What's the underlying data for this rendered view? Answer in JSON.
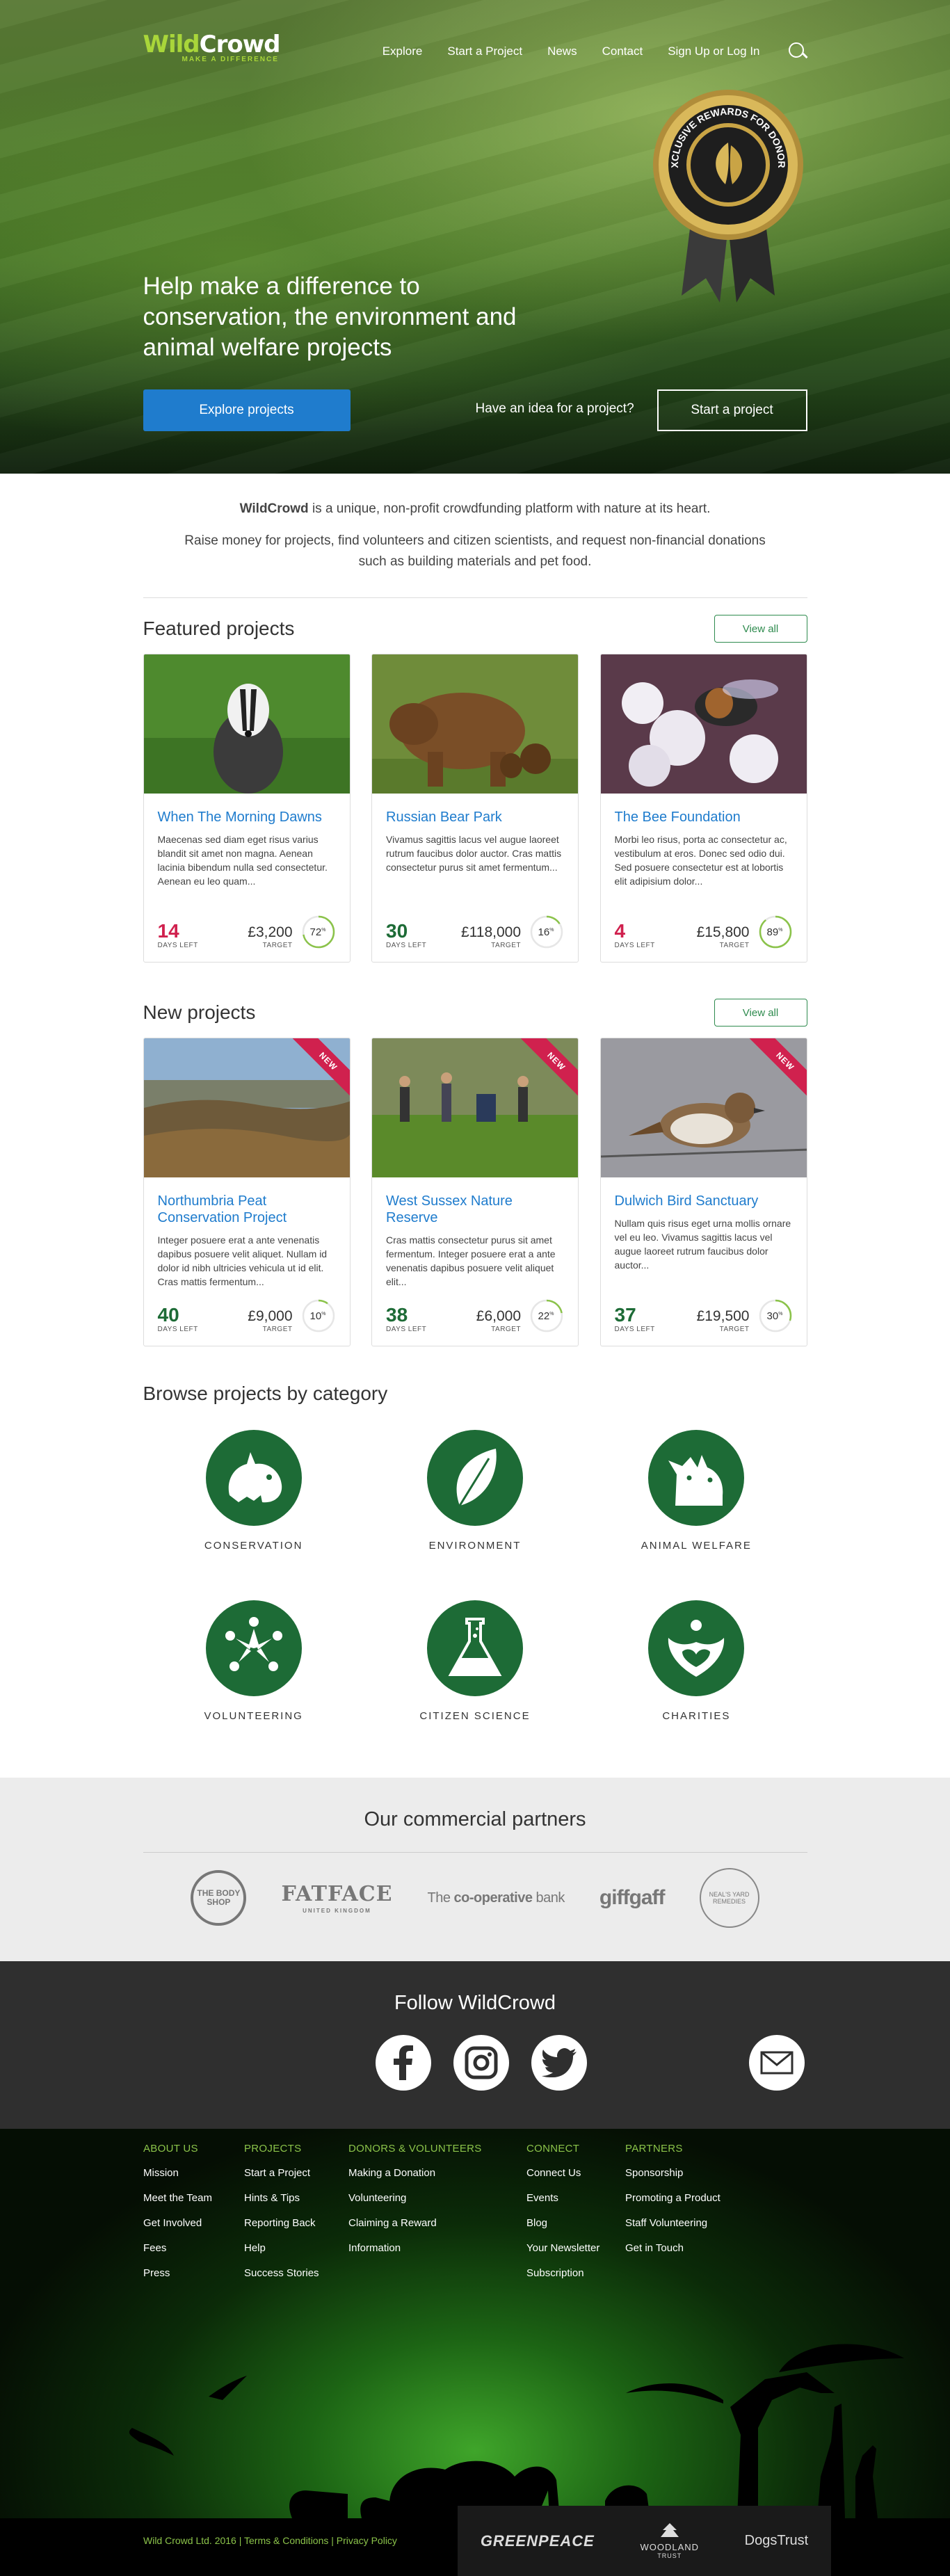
{
  "header": {
    "logo_wild": "Wild",
    "logo_crowd": "Crowd",
    "logo_tagline": "MAKE A DIFFERENCE",
    "nav": [
      "Explore",
      "Start a Project",
      "News",
      "Contact",
      "Sign Up or Log In"
    ],
    "medal_text": "EXCLUSIVE REWARDS FOR DONORS"
  },
  "hero": {
    "headline": "Help make a difference to conservation, the environment and animal welfare projects",
    "explore_button": "Explore projects",
    "idea_text": "Have an idea for a project?",
    "start_button": "Start a project"
  },
  "intro": {
    "brand": "WildCrowd",
    "line1_rest": " is a unique, non-profit crowdfunding platform with nature at its heart.",
    "line2": "Raise money for projects, find volunteers and citizen scientists, and request non-financial donations such as building materials and pet food."
  },
  "featured": {
    "title": "Featured projects",
    "view_all": "View all",
    "cards": [
      {
        "title": "When The Morning Dawns",
        "desc": "Maecenas sed diam eget risus varius blandit sit amet non magna. Aenean lacinia bibendum nulla sed consectetur. Aenean eu leo quam...",
        "days": "14",
        "days_label": "DAYS LEFT",
        "amount": "£3,200",
        "amount_label": "TARGET",
        "percent": "72",
        "percent_value": 72,
        "days_color": "#d0214e"
      },
      {
        "title": "Russian Bear Park",
        "desc": "Vivamus sagittis lacus vel augue laoreet rutrum faucibus dolor auctor. Cras mattis consectetur purus sit amet fermentum...",
        "days": "30",
        "days_label": "DAYS LEFT",
        "amount": "£118,000",
        "amount_label": "TARGET",
        "percent": "16",
        "percent_value": 16,
        "days_color": "#1d6b36"
      },
      {
        "title": "The Bee Foundation",
        "desc": "Morbi leo risus, porta ac consectetur ac, vestibulum at eros. Donec sed odio dui. Sed posuere consectetur est at lobortis elit adipisium dolor...",
        "days": "4",
        "days_label": "DAYS LEFT",
        "amount": "£15,800",
        "amount_label": "TARGET",
        "percent": "89",
        "percent_value": 89,
        "days_color": "#d0214e"
      }
    ]
  },
  "new": {
    "title": "New projects",
    "view_all": "View all",
    "ribbon": "NEW",
    "cards": [
      {
        "title": "Northumbria Peat Conservation Project",
        "desc": "Integer posuere erat a ante venenatis dapibus posuere velit aliquet. Nullam id dolor id nibh ultricies vehicula ut id elit. Cras mattis fermentum...",
        "days": "40",
        "days_label": "DAYS LEFT",
        "amount": "£9,000",
        "amount_label": "TARGET",
        "percent": "10",
        "percent_value": 10,
        "days_color": "#1d6b36"
      },
      {
        "title": "West Sussex Nature Reserve",
        "desc": "Cras mattis consectetur purus sit amet fermentum. Integer posuere erat a ante venenatis dapibus posuere velit aliquet elit...",
        "days": "38",
        "days_label": "DAYS LEFT",
        "amount": "£6,000",
        "amount_label": "TARGET",
        "percent": "22",
        "percent_value": 22,
        "days_color": "#1d6b36"
      },
      {
        "title": "Dulwich Bird Sanctuary",
        "desc": "Nullam quis risus eget urna mollis ornare vel eu leo. Vivamus sagittis lacus vel augue laoreet rutrum faucibus dolor auctor...",
        "days": "37",
        "days_label": "DAYS LEFT",
        "amount": "£19,500",
        "amount_label": "TARGET",
        "percent": "30",
        "percent_value": 30,
        "days_color": "#1d6b36"
      }
    ]
  },
  "categories": {
    "title": "Browse projects by category",
    "items": [
      "CONSERVATION",
      "ENVIRONMENT",
      "ANIMAL WELFARE",
      "VOLUNTEERING",
      "CITIZEN SCIENCE",
      "CHARITIES"
    ]
  },
  "partners": {
    "title": "Our commercial partners",
    "body_shop": "THE BODY SHOP",
    "fatface": "FATFACE",
    "fatface_sub": "UNITED KINGDOM",
    "coop_pre": "The ",
    "coop_bold": "co-operative",
    "coop_post": " bank",
    "giffgaff": "giffgaff",
    "neals": "NEAL'S YARD REMEDIES"
  },
  "follow": {
    "title": "Follow WildCrowd"
  },
  "footer": {
    "columns": [
      {
        "heading": "ABOUT US",
        "links": [
          "Mission",
          "Meet the Team",
          "Get Involved",
          "Fees",
          "Press"
        ]
      },
      {
        "heading": "PROJECTS",
        "links": [
          "Start a Project",
          "Hints & Tips",
          "Reporting Back",
          "Help",
          "Success Stories"
        ]
      },
      {
        "heading": "DONORS & VOLUNTEERS",
        "links": [
          "Making a Donation",
          "Volunteering",
          "Claiming a Reward",
          "Information"
        ]
      },
      {
        "heading": "CONNECT",
        "links": [
          "Connect Us",
          "Events",
          "Blog",
          "Your  Newsletter",
          " Subscription"
        ]
      },
      {
        "heading": "PARTNERS",
        "links": [
          "Sponsorship",
          " Promoting a Product",
          "Staff Volunteering",
          "Get in Touch"
        ]
      }
    ],
    "copyright": "Wild Crowd Ltd. 2016 | Terms & Conditions | Privacy Policy",
    "greenpeace": "GREENPEACE",
    "woodland": "WOODLAND",
    "woodland_sub": "TRUST",
    "dogstrust": "DogsTrust"
  },
  "colors": {
    "brand_green": "#1d6b36",
    "accent_lime": "#a9d63a",
    "link_blue": "#1f7ccd",
    "alert_red": "#d0214e"
  }
}
